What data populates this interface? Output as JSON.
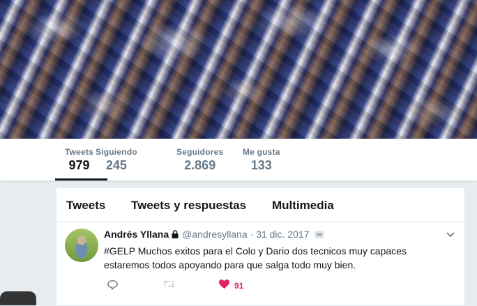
{
  "profile_nav": {
    "stats": [
      {
        "label": "Tweets",
        "value": "979",
        "active": true
      },
      {
        "label": "Siguiendo",
        "value": "245"
      },
      {
        "label": "Seguidores",
        "value": "2.869"
      },
      {
        "label": "Me gusta",
        "value": "133"
      }
    ]
  },
  "timeline": {
    "tabs": [
      {
        "label": "Tweets"
      },
      {
        "label": "Tweets y respuestas"
      },
      {
        "label": "Multimedia"
      }
    ],
    "tweet": {
      "fullname": "Andrés Yllana",
      "handle": "@andresyllana",
      "separator": "·",
      "time": "31 dic. 2017",
      "text": "#GELP Muchos exitos para el Colo y Dario dos tecnicos muy capaces estaremos todos apoyando para que salga todo muy bien.",
      "like_count": "91",
      "icons": {
        "lock": "lock-icon",
        "translate": "translate-icon",
        "caret": "chevron-down-icon",
        "reply": "reply-icon",
        "retweet": "retweet-icon",
        "like": "heart-icon"
      },
      "colors": {
        "like": "#e0245e",
        "muted": "#657786",
        "text": "#14171a"
      }
    }
  }
}
